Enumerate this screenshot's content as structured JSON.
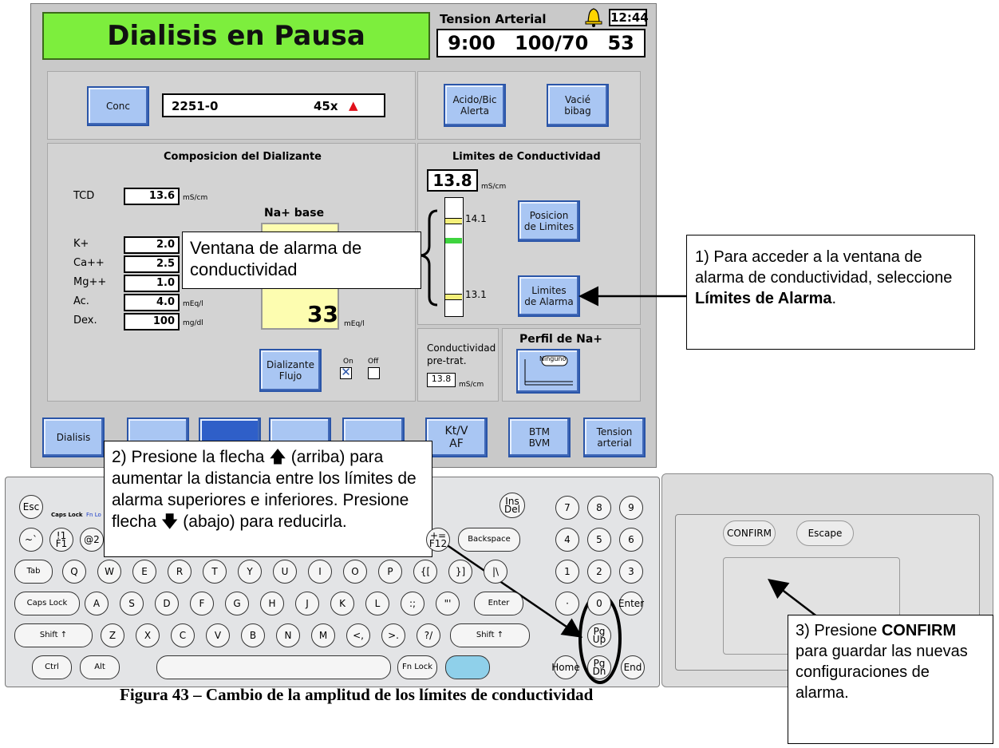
{
  "screen": {
    "title": "Dialisis en Pausa",
    "bp_label": "Tension Arterial",
    "clock": "12:44",
    "bp_time": "9:00",
    "bp_pressure": "100/70",
    "bp_pulse": "53"
  },
  "conc": {
    "button": "Conc",
    "value": "2251-0",
    "ratio": "45x",
    "alert_symbol": "▲"
  },
  "top_buttons": {
    "acido_line1": "Acido/Bic",
    "acido_line2": "Alerta",
    "vacie_line1": "Vacié",
    "vacie_line2": "bibag"
  },
  "composition": {
    "title": "Composicion del Dializante",
    "tcd_label": "TCD",
    "tcd_value": "13.6",
    "tcd_unit": "mS/cm",
    "rows": [
      {
        "label": "K+",
        "value": "2.0",
        "unit": ""
      },
      {
        "label": "Ca++",
        "value": "2.5",
        "unit": ""
      },
      {
        "label": "Mg++",
        "value": "1.0",
        "unit": ""
      },
      {
        "label": "Ac.",
        "value": "4.0",
        "unit": "mEq/l"
      },
      {
        "label": "Dex.",
        "value": "100",
        "unit": "mg/dl"
      }
    ],
    "na_title": "Na+ base",
    "na_value": "33",
    "na_unit": "mEq/l",
    "flow_line1": "Dializante",
    "flow_line2": "Flujo",
    "on_label": "On",
    "off_label": "Off",
    "on_checked": "☒"
  },
  "limits": {
    "title": "Limites de Conductividad",
    "value": "13.8",
    "unit": "mS/cm",
    "upper": "14.1",
    "lower": "13.1",
    "pos_line1": "Posicion",
    "pos_line2": "de Limites",
    "alarm_line1": "Limites",
    "alarm_line2": "de Alarma"
  },
  "pretreat": {
    "line1": "Conductividad",
    "line2": "pre-trat.",
    "value": "13.8",
    "unit": "mS/cm"
  },
  "na_profile": {
    "title": "Perfil de Na+",
    "badge": "Ninguno"
  },
  "bottom_tabs": {
    "dialisis": "Dialisis",
    "ktv_line1": "Kt/V",
    "ktv_line2": "AF",
    "btm_line1": "BTM",
    "btm_line2": "BVM",
    "tension_line1": "Tension",
    "tension_line2": "arterial"
  },
  "callouts": {
    "window_label": "Ventana de alarma de conductividad",
    "step1_a": "1) Para acceder a la ventana de alarma de conductividad, seleccione ",
    "step1_b": "Límites de Alarma",
    "step1_c": ".",
    "step2_a": "2) Presione la flecha ",
    "step2_up": "🡅",
    "step2_b": " (arriba) para aumentar la distancia entre los límites de alarma superiores e inferiores. Presione flecha ",
    "step2_down": "🡇",
    "step2_c": " (abajo) para reducirla.",
    "step3_a": "3) Presione ",
    "step3_b": "CONFIRM",
    "step3_c": " para guardar las nuevas configuraciones de alarma."
  },
  "keyboard": {
    "esc": "Esc",
    "caps_indicator": "Caps Lock",
    "fn_indicator": "Fn Lo",
    "row1": [
      "~`",
      "!1 F1",
      "@2"
    ],
    "f12": "+= F12",
    "backspace": "Backspace",
    "ins_del": "Ins Del",
    "numpad": [
      "7",
      "8",
      "9",
      "4",
      "5",
      "6",
      "1",
      "2",
      "3",
      "·",
      "0",
      "Enter"
    ],
    "tab": "Tab",
    "qrow": [
      "Q",
      "W",
      "E",
      "R",
      "T",
      "Y",
      "U",
      "I",
      "O",
      "P",
      "{[",
      "}]",
      "|\\"
    ],
    "caps": "Caps Lock",
    "arow": [
      "A",
      "S",
      "D",
      "F",
      "G",
      "H",
      "J",
      "K",
      "L",
      ":;",
      "\"'"
    ],
    "enter": "Enter",
    "shift": "Shift ↑",
    "zrow": [
      "Z",
      "X",
      "C",
      "V",
      "B",
      "N",
      "M",
      "<,",
      ">.",
      "?/"
    ],
    "ctrl": "Ctrl",
    "alt": "Alt",
    "fn_lock": "Fn Lock",
    "pgup": "Pg Up",
    "pgdn": "Pg Dn",
    "home": "Home",
    "end": "End"
  },
  "confirm_panel": {
    "confirm": "CONFIRM",
    "escape": "Escape"
  },
  "caption": "Figura 43 – Cambio de la amplitud de los límites de conductividad"
}
